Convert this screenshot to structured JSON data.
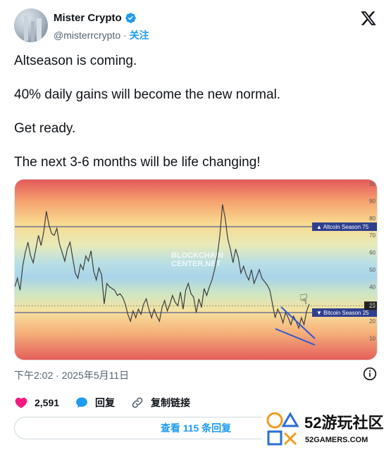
{
  "author": {
    "name": "Mister Crypto",
    "handle": "@misterrcrypto",
    "separator": "·",
    "follow_label": "关注"
  },
  "icons": {
    "verified": "verified-badge-icon",
    "brand": "x-logo-icon",
    "info": "info-icon",
    "like": "heart-icon",
    "reply": "speech-bubble-icon",
    "copy_link": "link-icon"
  },
  "tweet_lines": [
    "Altseason is coming.",
    "40% daily gains will become the new normal.",
    "Get ready.",
    "The next 3-6 months will be life changing!"
  ],
  "timestamp": "下午2:02 · 2025年5月11日",
  "actions": {
    "like_count": "2,591",
    "reply_label": "回复",
    "copy_link_label": "复制链接"
  },
  "view_replies_label": "查看 115 条回复",
  "watermark": {
    "brand": "52游玩社区",
    "domain": "52GAMERS.COM"
  },
  "colors": {
    "accent": "#1d9bf0",
    "like": "#f91880",
    "text": "#0f1419",
    "muted": "#536471"
  },
  "chart_data": {
    "type": "line",
    "watermark_text": [
      "BLOCKCHAIN",
      "CENTER.NET"
    ],
    "ylim": [
      0,
      100
    ],
    "y_ticks": [
      "10",
      "20",
      "30",
      "40",
      "50",
      "60",
      "70",
      "80",
      "90",
      "10"
    ],
    "reference_lines": [
      {
        "label": "▲ Altcoin Season",
        "value": 75
      },
      {
        "label": "▼ Bitcoin Season",
        "value": 25
      }
    ],
    "current_value": 29,
    "series": [
      {
        "values": [
          40,
          45,
          38,
          52,
          60,
          66,
          58,
          54,
          62,
          70,
          64,
          72,
          84,
          76,
          71,
          70,
          74,
          65,
          60,
          55,
          62,
          66,
          57,
          48,
          45,
          53,
          50,
          58,
          55,
          61,
          49,
          44,
          51,
          47,
          30,
          42,
          40,
          39,
          38,
          35,
          36,
          34,
          30,
          24,
          20,
          26,
          22,
          27,
          24,
          30,
          33,
          27,
          22,
          27,
          23,
          20,
          28,
          32,
          26,
          30,
          35,
          31,
          29,
          37,
          27,
          38,
          42,
          36,
          34,
          25,
          33,
          28,
          39,
          35,
          40,
          44,
          50,
          58,
          70,
          88,
          80,
          68,
          62,
          54,
          62,
          57,
          48,
          52,
          47,
          44,
          50,
          42,
          46,
          50,
          45,
          43,
          41,
          38,
          30,
          22,
          27,
          24,
          19,
          25,
          22,
          18,
          23,
          20,
          16,
          22,
          18,
          26,
          30
        ]
      }
    ]
  }
}
